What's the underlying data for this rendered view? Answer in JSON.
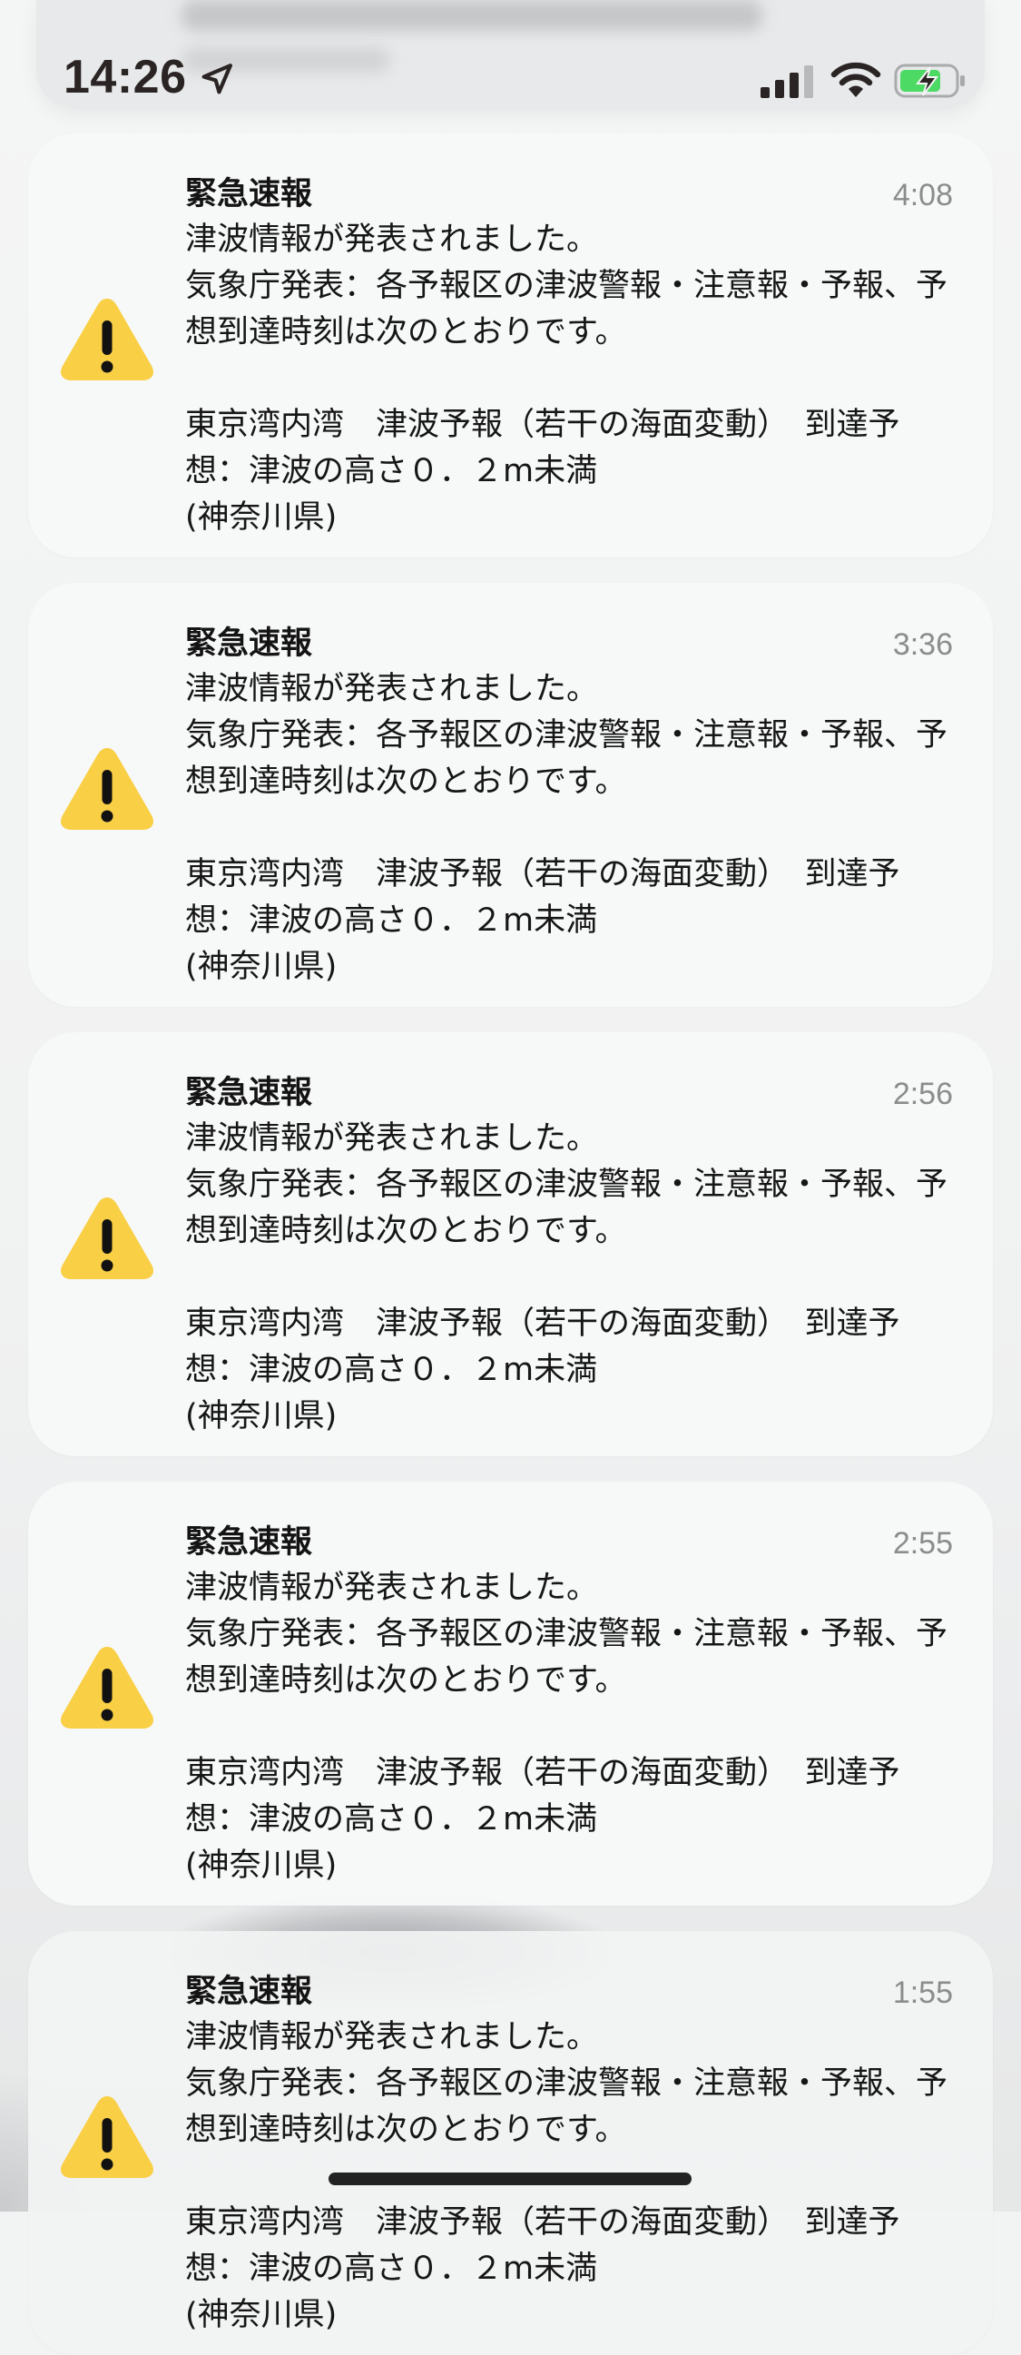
{
  "status_bar": {
    "time": "14:26",
    "location_icon": "location-arrow-icon",
    "signal_icon": "cellular-signal-icon",
    "wifi_icon": "wifi-icon",
    "battery_icon": "battery-charging-icon",
    "battery_color": "#4cd964"
  },
  "notifications": [
    {
      "icon": "warning-icon",
      "title": "緊急速報",
      "time": "4:08",
      "body": "津波情報が発表されました。\n気象庁発表：各予報区の津波警報・注意報・予報、予想到達時刻は次のとおりです。\n\n東京湾内湾　津波予報（若干の海面変動）　到達予想：津波の高さ０．２m未満\n(神奈川県)"
    },
    {
      "icon": "warning-icon",
      "title": "緊急速報",
      "time": "3:36",
      "body": "津波情報が発表されました。\n気象庁発表：各予報区の津波警報・注意報・予報、予想到達時刻は次のとおりです。\n\n東京湾内湾　津波予報（若干の海面変動）　到達予想：津波の高さ０．２m未満\n(神奈川県)"
    },
    {
      "icon": "warning-icon",
      "title": "緊急速報",
      "time": "2:56",
      "body": "津波情報が発表されました。\n気象庁発表：各予報区の津波警報・注意報・予報、予想到達時刻は次のとおりです。\n\n東京湾内湾　津波予報（若干の海面変動）　到達予想：津波の高さ０．２m未満\n(神奈川県)"
    },
    {
      "icon": "warning-icon",
      "title": "緊急速報",
      "time": "2:55",
      "body": "津波情報が発表されました。\n気象庁発表：各予報区の津波警報・注意報・予報、予想到達時刻は次のとおりです。\n\n東京湾内湾　津波予報（若干の海面変動）　到達予想：津波の高さ０．２m未満\n(神奈川県)"
    },
    {
      "icon": "warning-icon",
      "title": "緊急速報",
      "time": "1:55",
      "body": "津波情報が発表されました。\n気象庁発表：各予報区の津波警報・注意報・予報、予想到達時刻は次のとおりです。\n\n東京湾内湾　津波予報（若干の海面変動）　到達予想：津波の高さ０．２m未満\n(神奈川県)"
    }
  ],
  "colors": {
    "warning_yellow": "#f9cf45",
    "card_background": "#f7f8f8",
    "time_gray": "#8b8c8d"
  }
}
